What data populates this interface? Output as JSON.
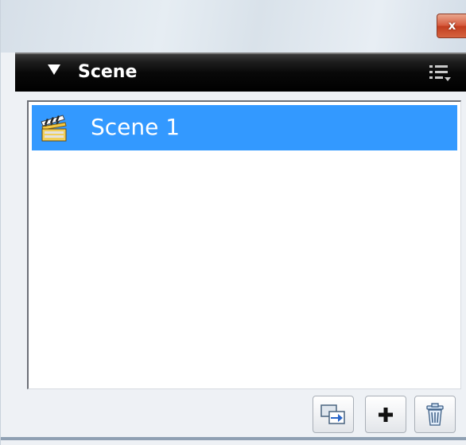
{
  "window": {
    "close_icon": "close-x-icon",
    "close_glyph": "x"
  },
  "panel": {
    "title": "Scene",
    "collapse_icon": "triangle-down-icon",
    "menu_icon": "panel-options-menu-icon"
  },
  "scenes": [
    {
      "label": "Scene 1",
      "icon": "clapperboard-icon",
      "selected": true
    }
  ],
  "footer": {
    "buttons": [
      {
        "name": "duplicate-scene-button",
        "icon": "duplicate-scene-icon"
      },
      {
        "name": "add-scene-button",
        "icon": "plus-icon"
      },
      {
        "name": "delete-scene-button",
        "icon": "trash-icon"
      }
    ]
  },
  "colors": {
    "selection": "#3399ff",
    "header_bg": "#000000",
    "close_button": "#c8472a"
  }
}
